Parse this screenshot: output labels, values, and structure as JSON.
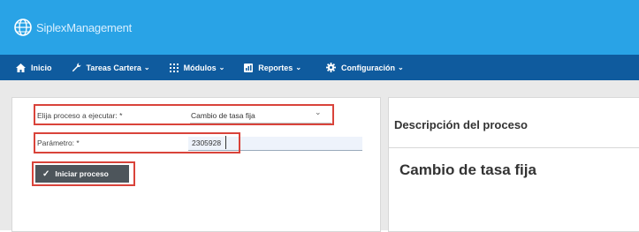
{
  "app": {
    "brand": "SiplexManagement"
  },
  "nav": [
    {
      "label": "Inicio",
      "icon": "home-icon",
      "has_caret": false
    },
    {
      "label": "Tareas Cartera",
      "icon": "wrench-icon",
      "has_caret": true
    },
    {
      "label": "Módulos",
      "icon": "grid-icon",
      "has_caret": true
    },
    {
      "label": "Reportes",
      "icon": "report-icon",
      "has_caret": true
    },
    {
      "label": "Configuración",
      "icon": "gear-icon",
      "has_caret": true
    }
  ],
  "form": {
    "process_label": "Elija proceso a ejecutar: *",
    "process_value": "Cambio de tasa fija",
    "param_label": "Parámetro: *",
    "param_value": "2305928",
    "start_button": "Iniciar proceso"
  },
  "description": {
    "title": "Descripción del proceso",
    "name": "Cambio de tasa fija"
  },
  "colors": {
    "header": "#29a3e6",
    "navbar": "#0f5b9e",
    "highlight": "#d9433a",
    "button": "#4d555b"
  }
}
